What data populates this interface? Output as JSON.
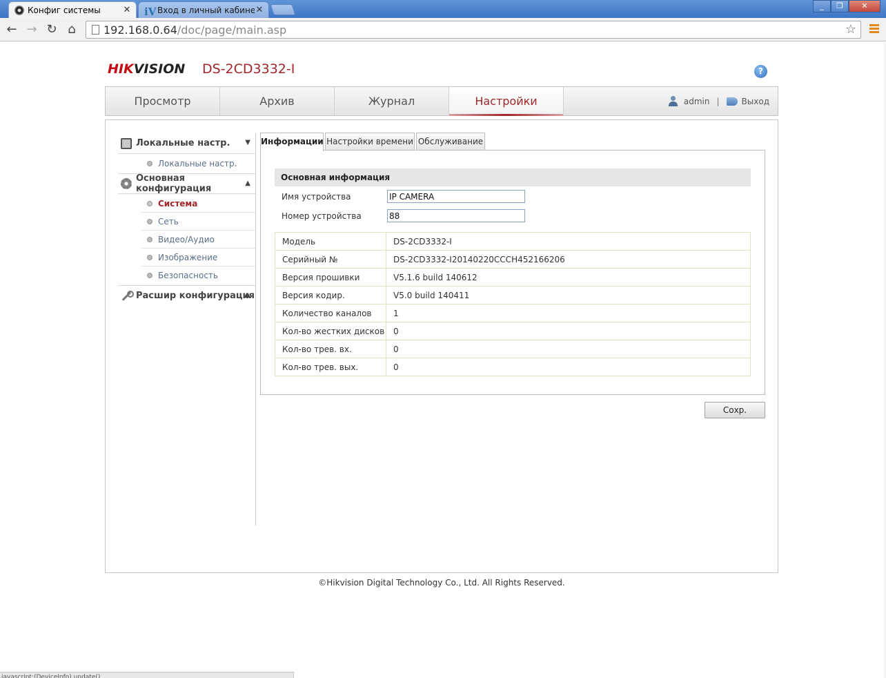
{
  "browser": {
    "tabs": [
      {
        "title": "Конфиг системы",
        "active": true
      },
      {
        "title": "Вход в личный кабинет | Iv",
        "active": false
      }
    ],
    "url_host": "192.168.0.64",
    "url_path": "/doc/page/main.asp",
    "status_text": "javascript:(DeviceInfo).update()"
  },
  "header": {
    "brand_hik": "HIK",
    "brand_vision": "VISION",
    "model": "DS-2CD3332-I",
    "help": "?"
  },
  "mainnav": {
    "tabs": [
      {
        "label": "Просмотр"
      },
      {
        "label": "Архив"
      },
      {
        "label": "Журнал"
      },
      {
        "label": "Настройки"
      }
    ],
    "user": "admin",
    "separator": "|",
    "logout": "Выход"
  },
  "sidebar": {
    "sections": [
      {
        "title": "Локальные настр.",
        "items": [
          "Локальные настр."
        ]
      },
      {
        "title": "Основная конфигурация",
        "items": [
          "Система",
          "Сеть",
          "Видео/Аудио",
          "Изображение",
          "Безопасность"
        ]
      },
      {
        "title": "Расшир конфигурация",
        "items": []
      }
    ]
  },
  "subtabs": [
    "Информации",
    "Настройки времени",
    "Обслуживание"
  ],
  "basic_info": {
    "title": "Основная информация",
    "device_name_label": "Имя устройства",
    "device_name_value": "IP CAMERA",
    "device_no_label": "Номер устройства",
    "device_no_value": "88"
  },
  "info_rows": [
    {
      "key": "Модель",
      "value": "DS-2CD3332-I"
    },
    {
      "key": "Серийный №",
      "value": "DS-2CD3332-I20140220CCCH452166206"
    },
    {
      "key": "Версия прошивки",
      "value": "V5.1.6 build 140612"
    },
    {
      "key": "Версия кодир.",
      "value": "V5.0 build 140411"
    },
    {
      "key": "Количество каналов",
      "value": "1"
    },
    {
      "key": "Кол-во жестких дисков",
      "value": "0"
    },
    {
      "key": "Кол-во трев. вх.",
      "value": "0"
    },
    {
      "key": "Кол-во трев. вых.",
      "value": "0"
    }
  ],
  "save_label": "Сохр.",
  "footer": "©Hikvision Digital Technology Co., Ltd. All Rights Reserved.",
  "colors": {
    "accent": "#a0262a",
    "brand_red": "#c40d13"
  }
}
